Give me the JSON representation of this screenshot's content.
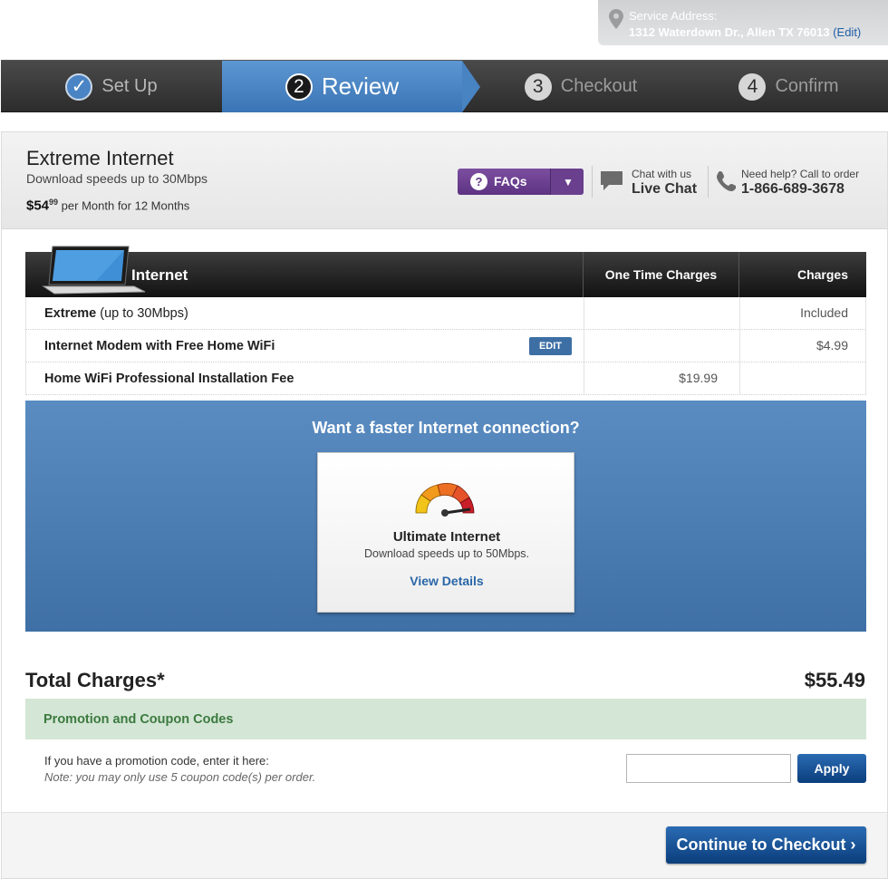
{
  "service": {
    "label": "Service Address:",
    "address": "1312 Waterdown Dr., Allen TX 76013",
    "edit": "(Edit)"
  },
  "steps": [
    {
      "num": "✓",
      "label": "Set Up",
      "state": "done"
    },
    {
      "num": "2",
      "label": "Review",
      "state": "active"
    },
    {
      "num": "3",
      "label": "Checkout",
      "state": "pending"
    },
    {
      "num": "4",
      "label": "Confirm",
      "state": "pending"
    }
  ],
  "product": {
    "title": "Extreme Internet",
    "subtitle": "Download speeds up to 30Mbps",
    "price_main": "$54",
    "price_cents": "99",
    "price_terms": "per Month for 12 Months"
  },
  "help": {
    "faq_label": "FAQs",
    "faq_icon": "?",
    "chat_small": "Chat with us",
    "chat_big": "Live Chat",
    "call_small": "Need help? Call to order",
    "call_big": "1-866-689-3678"
  },
  "table": {
    "headers": {
      "section": "Internet",
      "one_time": "One Time Charges",
      "charges": "Charges"
    },
    "rows": [
      {
        "name_bold": "Extreme",
        "name_rest": " (up to 30Mbps)",
        "one_time": "",
        "charges": "Included"
      },
      {
        "name_bold": "Internet Modem with Free Home WiFi",
        "name_rest": "",
        "edit": "EDIT",
        "one_time": "",
        "charges": "$4.99"
      },
      {
        "name_bold": "Home WiFi Professional Installation Fee",
        "name_rest": "",
        "one_time": "$19.99",
        "charges": ""
      }
    ]
  },
  "upsell": {
    "title": "Want a faster Internet connection?",
    "card_title": "Ultimate Internet",
    "card_sub": "Download speeds up to 50Mbps.",
    "card_link": "View Details",
    "gauge_colors": [
      "#f2c318",
      "#f19a1c",
      "#e5532a",
      "#c81e28"
    ]
  },
  "totals": {
    "label": "Total Charges*",
    "value": "$55.49"
  },
  "promo": {
    "bar_label": "Promotion and Coupon Codes",
    "instructions": "If you have a promotion code, enter it here:",
    "note": "Note: you may only use 5 coupon code(s) per order.",
    "input_value": "",
    "apply_label": "Apply"
  },
  "footer": {
    "continue_label": "Continue to Checkout ›"
  },
  "colors": {
    "accent": "#3a74b5",
    "purple": "#5d3383",
    "promo_green": "#3b7a3f",
    "button_blue": "#0b3e7c"
  }
}
